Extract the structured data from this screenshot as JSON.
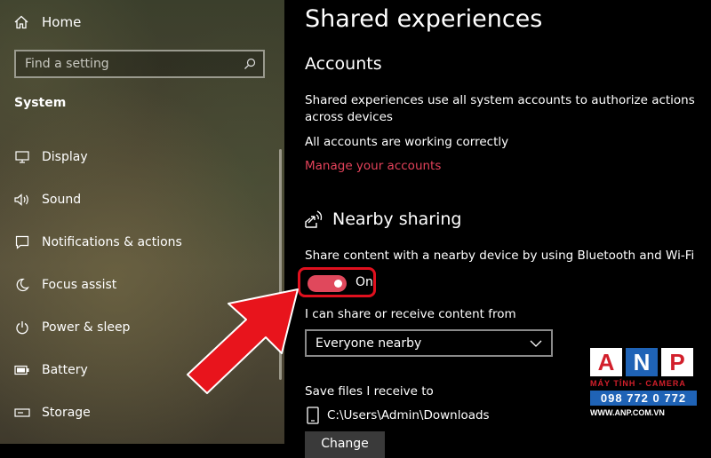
{
  "sidebar": {
    "home_label": "Home",
    "search_placeholder": "Find a setting",
    "section_title": "System",
    "items": [
      {
        "label": "Display",
        "icon": "monitor-icon"
      },
      {
        "label": "Sound",
        "icon": "speaker-icon"
      },
      {
        "label": "Notifications & actions",
        "icon": "notification-icon"
      },
      {
        "label": "Focus assist",
        "icon": "moon-icon"
      },
      {
        "label": "Power & sleep",
        "icon": "power-icon"
      },
      {
        "label": "Battery",
        "icon": "battery-icon"
      },
      {
        "label": "Storage",
        "icon": "storage-icon"
      }
    ]
  },
  "main": {
    "title": "Shared experiences",
    "accounts": {
      "heading": "Accounts",
      "description": "Shared experiences use all system accounts to authorize actions across devices",
      "status": "All accounts are working correctly",
      "manage_link": "Manage your accounts"
    },
    "nearby": {
      "heading": "Nearby sharing",
      "description": "Share content with a nearby device by using Bluetooth and Wi-Fi",
      "toggle_state": "On",
      "share_from_label": "I can share or receive content from",
      "share_from_value": "Everyone nearby",
      "save_label": "Save files I receive to",
      "save_path": "C:\\Users\\Admin\\Downloads",
      "change_button": "Change"
    }
  },
  "watermark": {
    "letters": [
      "A",
      "N",
      "P"
    ],
    "tagline": "MÁY TÍNH - CAMERA",
    "phone": "098 772 0 772",
    "website": "WWW.ANP.COM.VN"
  },
  "colors": {
    "accent": "#e3425a",
    "toggle_on": "#e0485c",
    "highlight_border": "#e0101e",
    "arrow": "#e8141c"
  }
}
